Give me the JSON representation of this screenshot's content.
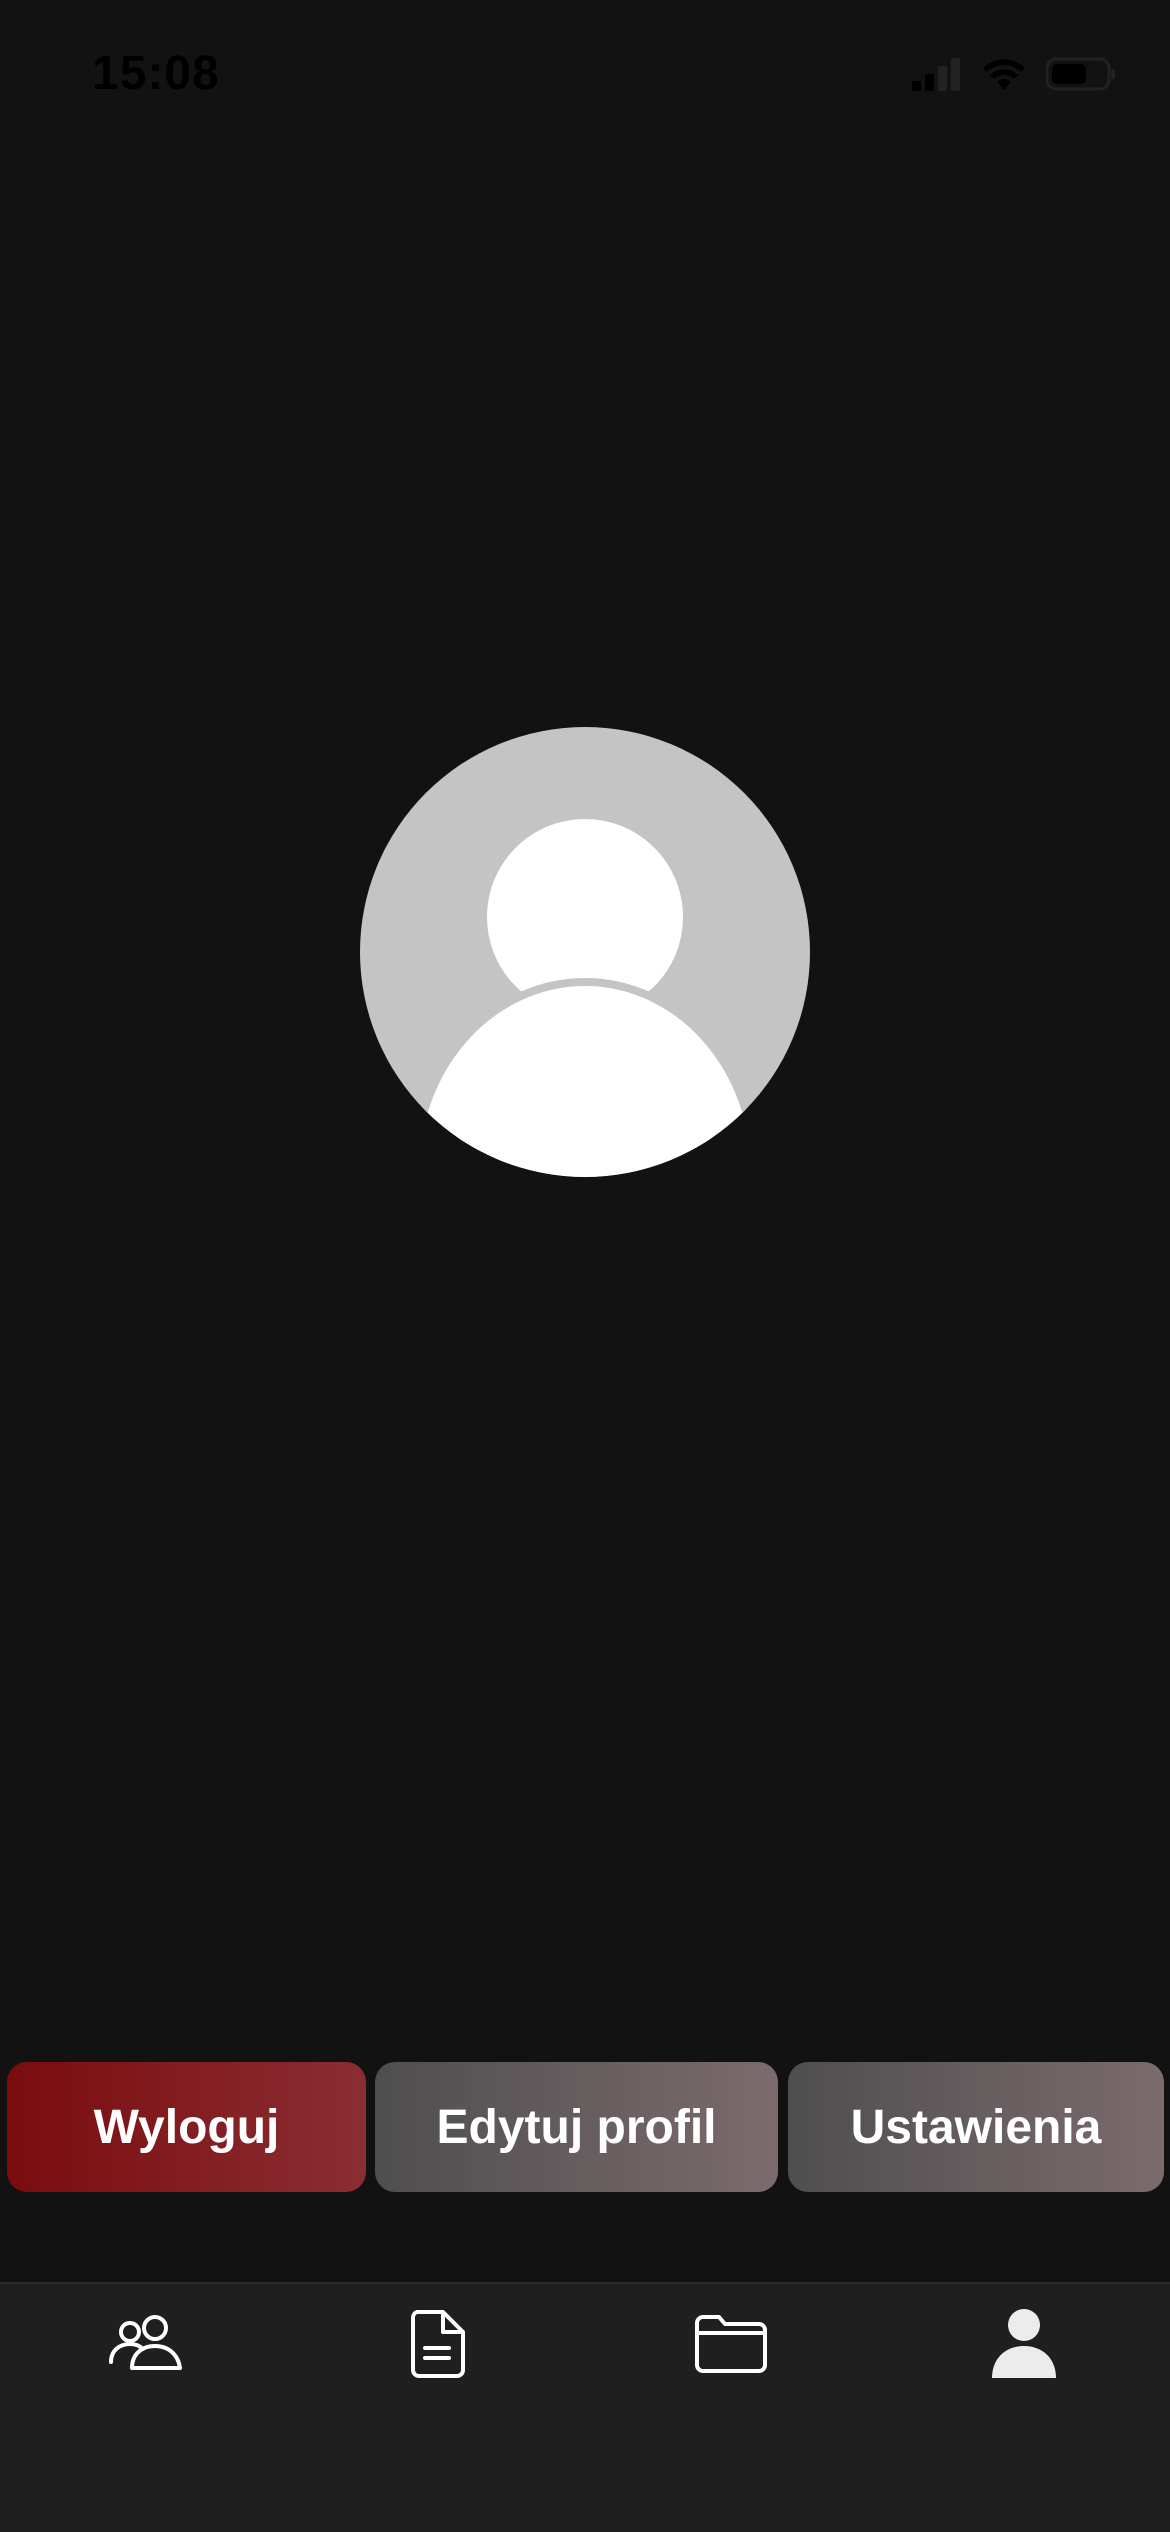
{
  "status_bar": {
    "time": "15:08",
    "icons": [
      "cellular-signal-icon",
      "wifi-icon",
      "battery-icon"
    ]
  },
  "profile": {
    "avatar_icon": "person-placeholder-icon"
  },
  "actions": {
    "logout_label": "Wyloguj",
    "edit_profile_label": "Edytuj profil",
    "settings_label": "Ustawienia"
  },
  "tab_bar": {
    "items": [
      {
        "icon": "people-icon",
        "active": false
      },
      {
        "icon": "document-icon",
        "active": false
      },
      {
        "icon": "folder-icon",
        "active": false
      },
      {
        "icon": "person-icon",
        "active": true
      }
    ]
  },
  "colors": {
    "background": "#121212",
    "logout_start": "#7a0c0e",
    "logout_end": "#8a2e33",
    "secondary_start": "#4f4e4f",
    "secondary_end": "#7b6b6d",
    "tab_bar": "#1f1f1f",
    "avatar_bg": "#c4c4c4"
  }
}
